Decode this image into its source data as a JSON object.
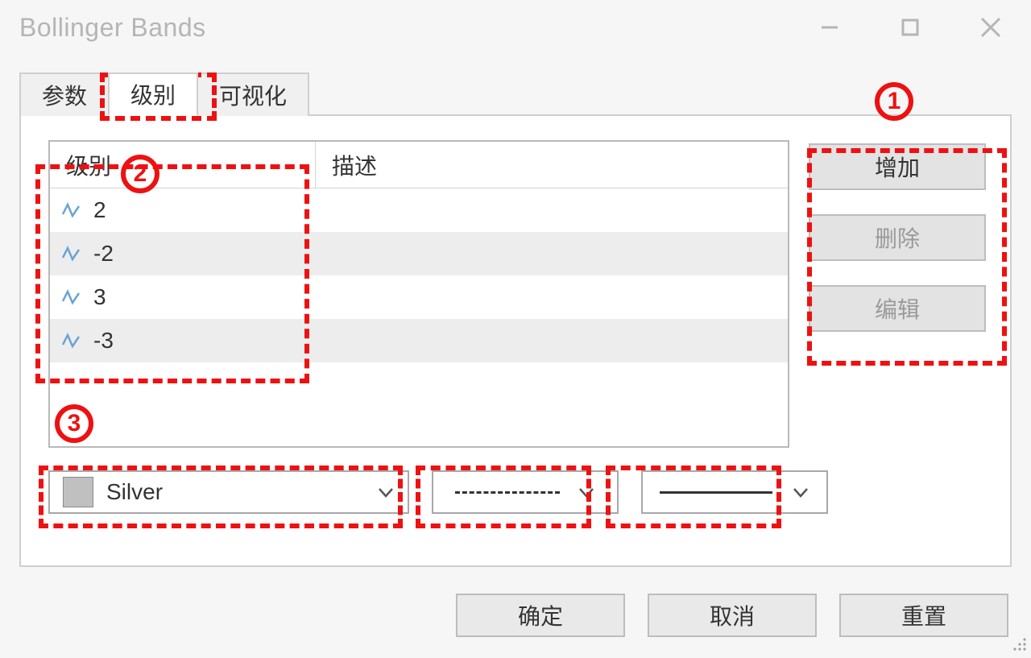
{
  "window": {
    "title": "Bollinger Bands"
  },
  "tabs": {
    "t0": "参数",
    "t1": "级别",
    "t2": "可视化"
  },
  "table": {
    "headers": {
      "level": "级别",
      "desc": "描述"
    },
    "rows": [
      {
        "level": "2",
        "desc": ""
      },
      {
        "level": "-2",
        "desc": ""
      },
      {
        "level": "3",
        "desc": ""
      },
      {
        "level": "-3",
        "desc": ""
      }
    ]
  },
  "side_buttons": {
    "add": "增加",
    "delete": "删除",
    "edit": "编辑"
  },
  "style": {
    "color_name": "Silver",
    "color_hex": "#c0c0c0"
  },
  "dialog": {
    "ok": "确定",
    "cancel": "取消",
    "reset": "重置"
  },
  "annotations": {
    "n1": "1",
    "n2": "2",
    "n3": "3"
  }
}
